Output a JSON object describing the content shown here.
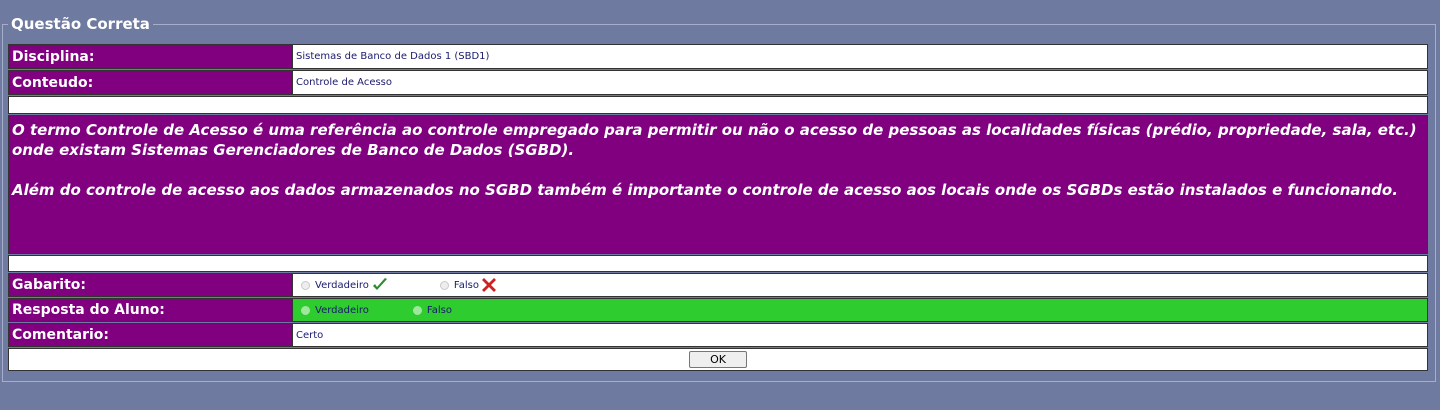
{
  "legend": "Questão Correta",
  "disciplina": {
    "label": "Disciplina:",
    "value": "Sistemas de Banco de Dados 1 (SBD1)"
  },
  "conteudo": {
    "label": "Conteudo:",
    "value": "Controle de Acesso"
  },
  "question": {
    "paragraph1": "O termo Controle de Acesso é uma referência ao controle empregado para permitir ou não o acesso de pessoas as localidades físicas (prédio, propriedade, sala, etc.) onde existam Sistemas Gerenciadores de Banco de Dados (SGBD).",
    "paragraph2": "Além do controle de acesso aos dados armazenados no SGBD também é importante o controle de acesso aos locais onde os SGBDs estão instalados e funcionando."
  },
  "gabarito": {
    "label": "Gabarito:",
    "option1": "Verdadeiro",
    "option2": "Falso"
  },
  "resposta": {
    "label": "Resposta do Aluno:",
    "option1": "Verdadeiro",
    "option2": "Falso",
    "bg_color": "#2ecc2e"
  },
  "comentario": {
    "label": "Comentario:",
    "value": "Certo"
  },
  "ok_button": "OK",
  "colors": {
    "purple": "#800080",
    "background": "#6f7aa0"
  }
}
